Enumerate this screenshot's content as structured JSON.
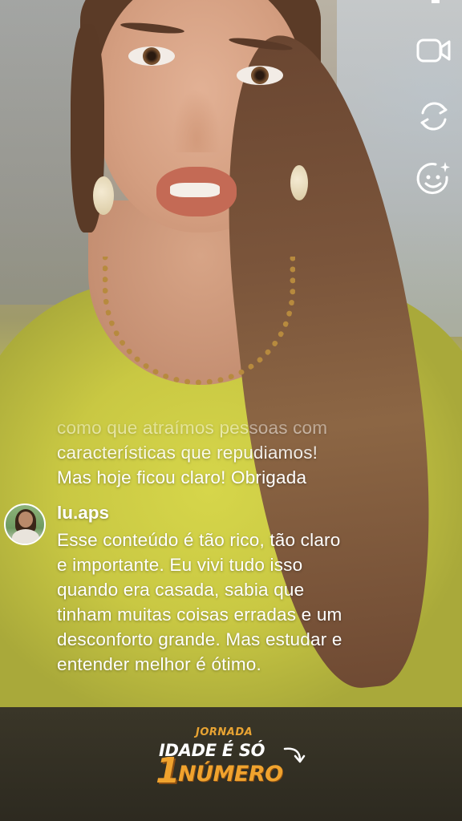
{
  "stream": {
    "controls": [
      {
        "name": "video-camera-icon"
      },
      {
        "name": "switch-camera-icon"
      },
      {
        "name": "face-effects-icon"
      }
    ]
  },
  "comments": {
    "previous": {
      "text": "como que atraímos pessoas com\ncaracterísticas que repudiamos!\nMas hoje ficou claro! Obrigada"
    },
    "current": {
      "username": "lu.aps",
      "text": "Esse conteúdo é tão rico, tão claro\ne importante.  Eu vivi tudo isso\nquando era casada, sabia que\ntinham muitas coisas erradas e um\ndesconforto grande. Mas estudar e\nentender melhor é ótimo."
    }
  },
  "banner": {
    "kicker": "JORNADA",
    "line1": "IDADE É SÓ",
    "digit": "1",
    "line2": "NÚMERO",
    "colors": {
      "accent": "#f0a32e",
      "background": "#2d2a20",
      "text": "#ffffff"
    }
  }
}
